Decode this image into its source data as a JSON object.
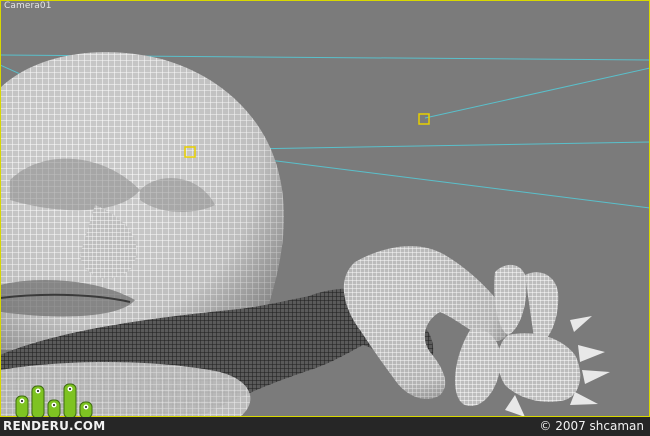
{
  "viewport": {
    "label": "Camera01",
    "background_color": "#7b7b7b",
    "border_color": "#d8d800",
    "wire_color": "#ffffff",
    "camera_line_color": "#58c4d0",
    "target_color": "#e8d000"
  },
  "footer": {
    "brand": "RENDERU.COM",
    "credit": "© 2007 shcaman",
    "mascot_color": "#7ec322"
  },
  "icons": [
    "camera-target-icon",
    "camera-target-icon",
    "mascot-logo"
  ]
}
